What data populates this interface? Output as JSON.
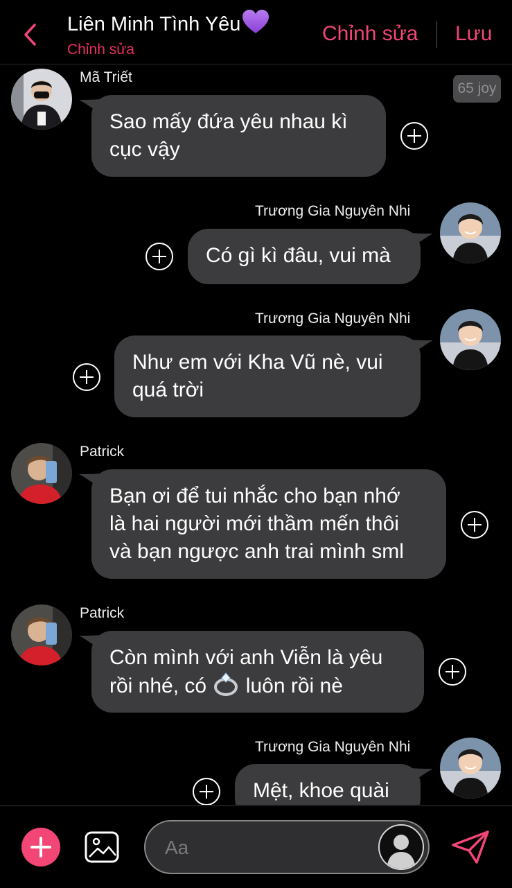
{
  "header": {
    "title": "Liên Minh Tình Yêu",
    "title_emoji": "purple-heart-icon",
    "subtitle": "Chỉnh sửa",
    "edit_label": "Chỉnh sửa",
    "save_label": "Lưu",
    "accent": "#f24676"
  },
  "joy_badge": "65 joy",
  "messages": [
    {
      "sender": "Mã Triết",
      "side": "left",
      "lines": [
        "Sao mấy đứa yêu nhau kì",
        "cục vậy"
      ]
    },
    {
      "sender": "Trương Gia Nguyên Nhi",
      "side": "right",
      "lines": [
        "Có gì kì đâu, vui mà"
      ]
    },
    {
      "sender": "Trương Gia Nguyên Nhi",
      "side": "right",
      "lines": [
        "Như em với Kha Vũ nè, vui",
        "quá trời"
      ]
    },
    {
      "sender": "Patrick",
      "side": "left",
      "lines": [
        "Bạn ơi để tui nhắc cho bạn nhớ",
        "là hai người mới thầm mến thôi",
        "và bạn ngược anh trai mình sml"
      ]
    },
    {
      "sender": "Patrick",
      "side": "left",
      "lines": [
        "Còn mình với anh Viễn là yêu",
        "rồi nhé, có",
        "luôn rồi nè"
      ],
      "emoji": "ring-icon"
    },
    {
      "sender": "Trương Gia Nguyên Nhi",
      "side": "right",
      "lines": [
        "Mệt, khoe quài"
      ]
    }
  ],
  "composer": {
    "placeholder": "Aa"
  },
  "colors": {
    "bubble": "#3c3c3e",
    "background": "#000000",
    "subtitle": "#e8315f"
  }
}
